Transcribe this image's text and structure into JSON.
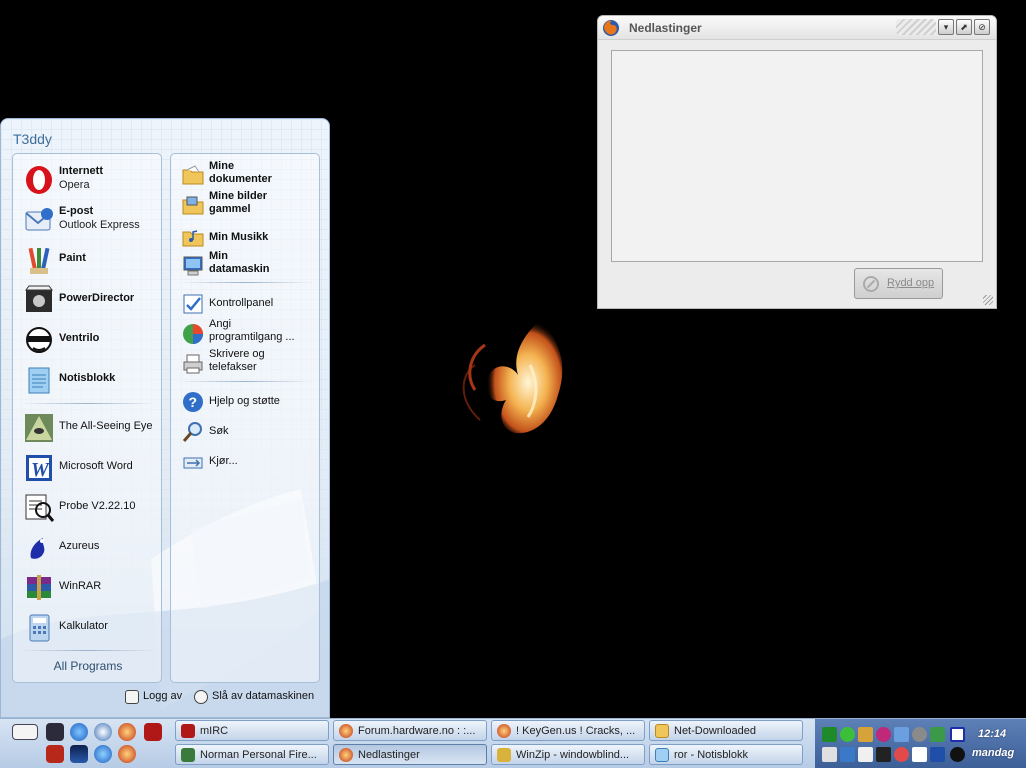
{
  "downloads_window": {
    "title": "Nedlastinger",
    "cleanup_label": "Rydd opp",
    "buttons": {
      "minimize": "▾",
      "maximize": "⬈",
      "close": "⊘"
    }
  },
  "start_menu": {
    "user": "T3ddy",
    "pinned": [
      {
        "title": "Internett",
        "subtitle": "Opera",
        "icon": "opera-icon"
      },
      {
        "title": "E-post",
        "subtitle": "Outlook Express",
        "icon": "outlook-express-icon"
      },
      {
        "title": "Paint",
        "icon": "paint-icon"
      },
      {
        "title": "PowerDirector",
        "icon": "powerdirector-icon"
      },
      {
        "title": "Ventrilo",
        "icon": "ventrilo-icon"
      },
      {
        "title": "Notisblokk",
        "icon": "notepad-icon"
      }
    ],
    "recent": [
      {
        "title": "The All-Seeing Eye",
        "icon": "all-seeing-eye-icon"
      },
      {
        "title": "Microsoft Word",
        "icon": "word-icon"
      },
      {
        "title": "Probe V2.22.10",
        "icon": "probe-icon"
      },
      {
        "title": "Azureus",
        "icon": "azureus-icon"
      },
      {
        "title": "WinRAR",
        "icon": "winrar-icon"
      },
      {
        "title": "Kalkulator",
        "icon": "calculator-icon"
      }
    ],
    "all_programs": "All Programs",
    "places": [
      {
        "line1": "Mine",
        "line2": "dokumenter",
        "bold": true,
        "icon": "folder-icon"
      },
      {
        "line1": "Mine bilder",
        "line2": "gammel",
        "bold": true,
        "icon": "folder-icon"
      },
      {
        "line1": "Min Musikk",
        "line2": "",
        "bold": true,
        "icon": "folder-icon"
      },
      {
        "line1": "Min",
        "line2": "datamaskin",
        "bold": true,
        "icon": "computer-icon"
      }
    ],
    "system": [
      {
        "line1": "Kontrollpanel",
        "line2": "",
        "icon": "control-panel-icon"
      },
      {
        "line1": "Angi",
        "line2": "programtilgang ...",
        "icon": "program-access-icon"
      },
      {
        "line1": "Skrivere og",
        "line2": "telefakser",
        "icon": "printer-icon"
      }
    ],
    "tools": [
      {
        "line1": "Hjelp og støtte",
        "icon": "help-icon"
      },
      {
        "line1": "Søk",
        "icon": "search-icon"
      },
      {
        "line1": "Kjør...",
        "icon": "run-icon"
      }
    ],
    "logoff": "Logg av",
    "shutdown": "Slå av datamaskinen"
  },
  "taskbar": {
    "buttons_row1": [
      {
        "label": "mIRC",
        "icon": "mirc-icon"
      },
      {
        "label": "Forum.hardware.no : :...",
        "icon": "firefox-icon"
      },
      {
        "label": "! KeyGen.us ! Cracks, ...",
        "icon": "firefox-icon"
      },
      {
        "label": "Net-Downloaded",
        "icon": "folder-icon"
      }
    ],
    "buttons_row2": [
      {
        "label": "Norman Personal Fire...",
        "icon": "norman-icon"
      },
      {
        "label": "Nedlastinger",
        "icon": "firefox-icon"
      },
      {
        "label": "WinZip - windowblind...",
        "icon": "winzip-icon"
      },
      {
        "label": "ror - Notisblokk",
        "icon": "notepad-icon"
      }
    ],
    "clock_time": "12:14",
    "clock_day": "mandag"
  },
  "colors": {
    "desktop": "#000000",
    "taskbar": "#c3d4ea",
    "tray": "#4a6ea8",
    "menu_blue": "#3d6f9a"
  }
}
